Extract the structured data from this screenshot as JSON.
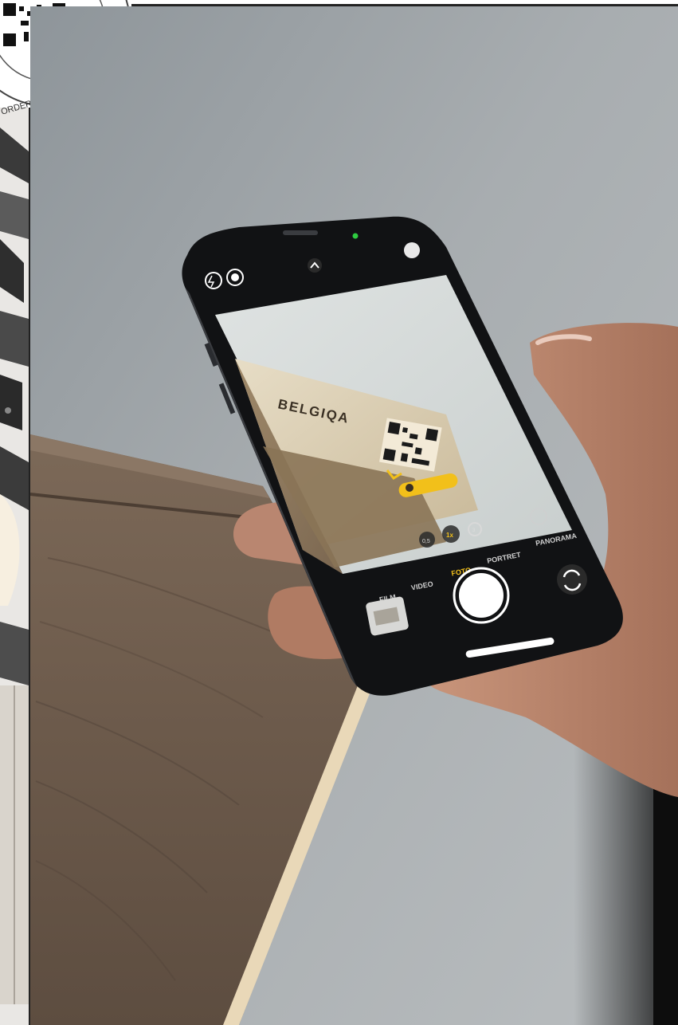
{
  "badge": {
    "text": "ORDER YOUR SAMPLE",
    "icon": "qr-code-icon"
  },
  "phone": {
    "brand_on_box": "BELGIQA",
    "camera_modes": [
      "FILM",
      "VIDEO",
      "FOTO",
      "PORTRET",
      "PANORAMA"
    ],
    "active_mode": "FOTO",
    "zoom_options": [
      "0,5",
      "1x",
      "3"
    ],
    "zoom_active": "1x",
    "icons": [
      "flash-icon",
      "live-photo-icon",
      "chevron-up-icon",
      "flip-camera-icon",
      "gallery-thumbnail-icon",
      "shutter-button-icon",
      "qr-code-icon"
    ]
  },
  "colors": {
    "wall": "#9aa0a4",
    "floor": "#6e5c4d",
    "phone_body": "#111214",
    "accent_yellow": "#f2c01a",
    "camera_dot": "#2ecc40"
  }
}
